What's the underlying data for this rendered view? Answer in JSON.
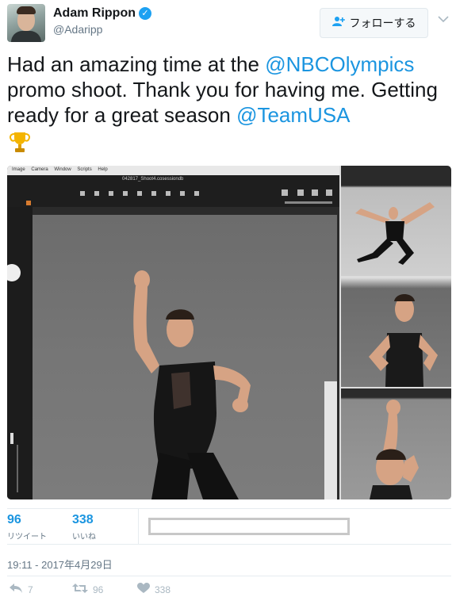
{
  "tweet": {
    "author": {
      "name": "Adam Rippon",
      "handle": "@Adaripp",
      "verified_glyph": "✓"
    },
    "follow_button": {
      "icon": "follow-person-icon",
      "label": "フォローする"
    },
    "text_parts": [
      "Had an amazing time at the ",
      "@NBCOlympics",
      " promo shoot. Thank you for having me. Getting ready for a great season ",
      "@TeamUSA"
    ],
    "emoji": "trophy-emoji",
    "photo_ui": {
      "menu_items": [
        "Image",
        "Camera",
        "Window",
        "Scripts",
        "Help"
      ],
      "file_name": "042817_Shoot4.cosessiondb"
    },
    "stats": {
      "retweets": {
        "count": "96",
        "label": "リツイート"
      },
      "likes": {
        "count": "338",
        "label": "いいね"
      }
    },
    "timestamp": "19:11 - 2017年4月29日",
    "actions": {
      "reply": {
        "icon": "reply-icon",
        "count": "7"
      },
      "retweet": {
        "icon": "retweet-icon",
        "count": "96"
      },
      "like": {
        "icon": "heart-icon",
        "count": "338"
      }
    }
  },
  "colors": {
    "link": "#1b95e0",
    "verified": "#1da1f2",
    "secondary_text": "#657786",
    "action_gray": "#aab8c2"
  }
}
